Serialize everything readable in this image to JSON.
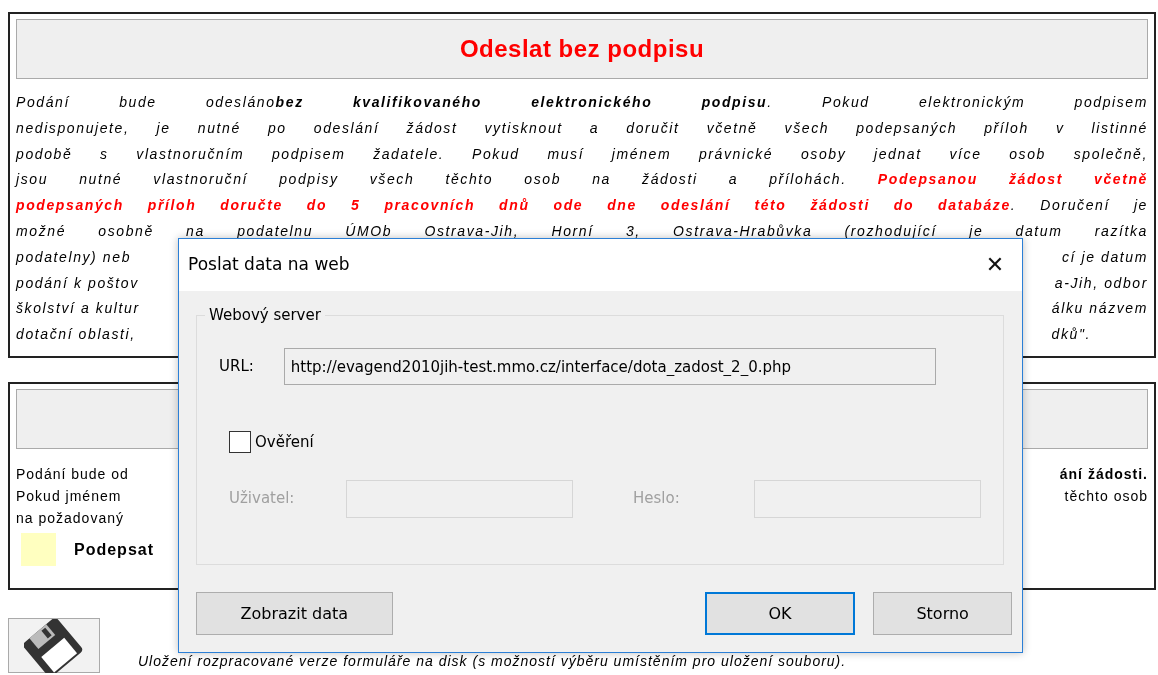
{
  "notice": {
    "title": "Odeslat bez podpisu",
    "lines": [
      {
        "segments": [
          {
            "text": "Podání bude odesláno",
            "bold": false,
            "highlighted": false
          },
          {
            "text": "bez kvalifikovaného elektronického podpisu",
            "bold": true,
            "highlighted": false
          },
          {
            "text": ". Pokud elektronickým podpisem",
            "bold": false,
            "highlighted": false
          }
        ]
      },
      {
        "segments": [
          {
            "text": "nedisponujete, je nutné po odeslání žádost vytisknout a doručit včetně všech podepsaných příloh v listinné",
            "bold": false,
            "highlighted": false
          }
        ]
      },
      {
        "segments": [
          {
            "text": "podobě s vlastnoručním podpisem žadatele. Pokud musí jménem právnické osoby jednat více osob společně,",
            "bold": false,
            "highlighted": false
          }
        ]
      },
      {
        "segments": [
          {
            "text": "jsou nutné vlastnoruční podpisy všech těchto osob na žádosti a přílohách. ",
            "bold": false,
            "highlighted": false
          },
          {
            "text": "Podepsanou žádost včetně",
            "bold": true,
            "highlighted": true
          }
        ]
      },
      {
        "segments": [
          {
            "text": "podepsaných příloh doručte do 5 pracovních dnů ode dne odeslání této žádosti do databáze",
            "bold": true,
            "highlighted": true
          },
          {
            "text": ". Doručení je",
            "bold": false,
            "highlighted": false
          }
        ]
      },
      {
        "segments": [
          {
            "text": "možné osobně na podatelnu ÚMOb Ostrava-Jih, Horní 3, Ostrava-Hrabůvka (rozhodující je datum razítka",
            "bold": false,
            "highlighted": false
          }
        ]
      }
    ],
    "partial_lines": [
      {
        "left": "podatelny) neb",
        "right": "cí je datum"
      },
      {
        "left": "podání k poštov",
        "right": "a-Jih, odbor"
      },
      {
        "left": "školství a kultur",
        "right": "álku názvem"
      },
      {
        "left": "dotační oblasti,",
        "right": "dků\"."
      }
    ]
  },
  "sign_notice": {
    "lines": [
      {
        "left": "Podání bude od",
        "right": "ání žádosti.",
        "right_bold": true
      },
      {
        "left": "Pokud jménem",
        "right": "těchto osob",
        "right_bold": false
      },
      {
        "left": "na požadovaný"
      }
    ],
    "legend": {
      "color": "#ffffc0",
      "label": "Podepsat"
    }
  },
  "save": {
    "description": "Uložení rozpracované verze formuláře na disk (s možností výběru umístěním pro uložení souboru)."
  },
  "dialog": {
    "title": "Poslat data na web",
    "close": "✕",
    "group": "Webový server",
    "url_label": "URL:",
    "url": "http://evagend2010jih-test.mmo.cz/interface/dota_zadost_2_0.php",
    "auth": {
      "label": "Ověření",
      "checked": false
    },
    "user_label": "Uživatel:",
    "password_label": "Heslo:",
    "fields_disabled": true,
    "buttons": [
      {
        "label": "Zobrazit data",
        "kind": "left",
        "default": false
      },
      {
        "label": "OK",
        "kind": "right",
        "default": true
      },
      {
        "label": "Storno",
        "kind": "right",
        "default": false
      }
    ]
  }
}
